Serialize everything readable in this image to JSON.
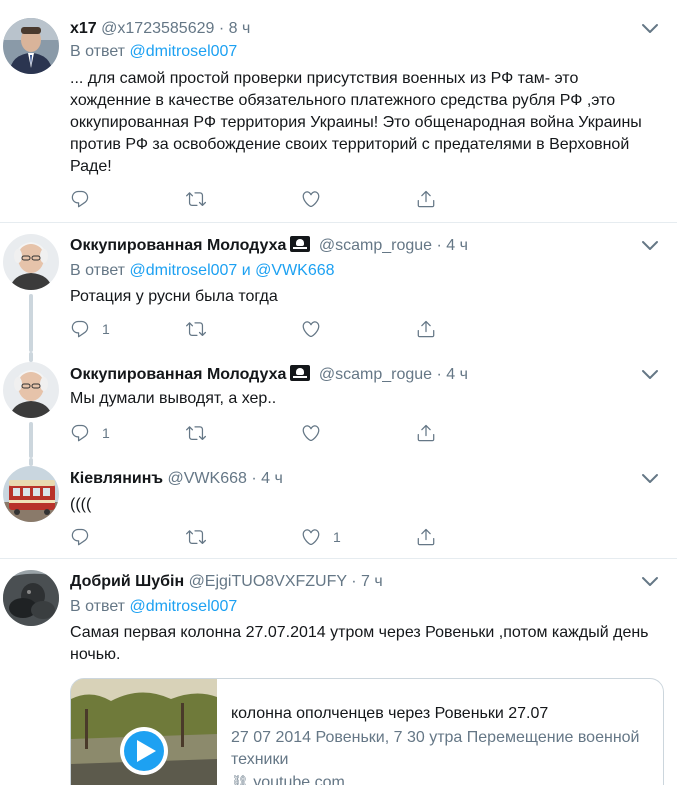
{
  "tweets": [
    {
      "name": "x17",
      "handle": "@x1723585629",
      "time": "8 ч",
      "reply_prefix": "В ответ",
      "reply_to": "@dmitrosel007",
      "text": "... для самой простой проверки присутствия военных из РФ там- это хожденние в качестве обязательного платежного средства рубля РФ ,это оккупированная РФ территория Украины! Это общенародная война Украины против РФ за освобождение своих территорий с  предателями в Верховной Раде!",
      "counts": {
        "reply": "",
        "retweet": "",
        "like": ""
      }
    },
    {
      "name": "Оккупированная Молодуха",
      "handle": "@scamp_rogue",
      "time": "4 ч",
      "reply_prefix": "В ответ",
      "reply_to": "@dmitrosel007",
      "reply_and": "и",
      "reply_to_2": "@VWK668",
      "text": "Ротация у русни была тогда",
      "counts": {
        "reply": "1",
        "retweet": "",
        "like": ""
      }
    },
    {
      "name": "Оккупированная Молодуха",
      "handle": "@scamp_rogue",
      "time": "4 ч",
      "text": "Мы думали выводят, а хер..",
      "counts": {
        "reply": "1",
        "retweet": "",
        "like": ""
      }
    },
    {
      "name": "Кiевлянинъ",
      "handle": "@VWK668",
      "time": "4 ч",
      "text": "((((",
      "counts": {
        "reply": "",
        "retweet": "",
        "like": "1"
      }
    },
    {
      "name": "Добрий Шубін",
      "handle": "@EjgiTUO8VXFZUFY",
      "time": "7 ч",
      "reply_prefix": "В ответ",
      "reply_to": "@dmitrosel007",
      "text": "Самая первая колонна 27.07.2014 утром через Ровеньки ,потом каждый день ночью.",
      "card": {
        "title": "колонна ополченцев через Ровеньки 27.07",
        "description": "27 07 2014 Ровеньки, 7 30 утра Перемещение военной техники",
        "domain": "youtube.com"
      }
    }
  ],
  "colors": {
    "link": "#1da1f2",
    "muted": "#657786",
    "thread_line": "#ccd6dd",
    "separator": "#e6ecf0"
  },
  "icons": {
    "reply": "reply-icon",
    "retweet": "retweet-icon",
    "like": "heart-icon",
    "share": "share-icon",
    "more": "chevron-down-icon",
    "play": "play-icon"
  }
}
